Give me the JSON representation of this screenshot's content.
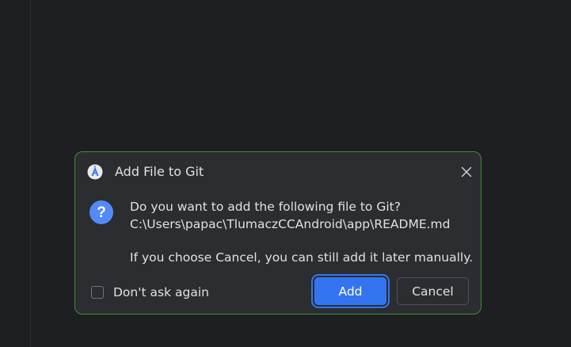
{
  "dialog": {
    "title": "Add File to Git",
    "icon": "android-studio-icon",
    "close_icon": "close-icon",
    "question_icon": "question-icon",
    "message_line1": "Do you want to add the following file to Git?",
    "message_line2": "C:\\Users\\papac\\TlumaczCCAndroid\\app\\README.md",
    "message_line3": "If you choose Cancel, you can still add it later manually.",
    "checkbox_label": "Don't ask again",
    "checkbox_checked": false,
    "add_label": "Add",
    "cancel_label": "Cancel"
  },
  "colors": {
    "background": "#1e1f22",
    "dialog_bg": "#2b2d30",
    "dialog_border": "#3f8c3a",
    "accent": "#3574f0",
    "text": "#dfe1e5"
  }
}
